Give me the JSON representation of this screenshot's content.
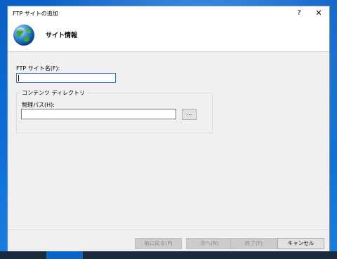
{
  "window": {
    "title": "FTP サイトの追加",
    "help_glyph": "?",
    "close_glyph": "✕"
  },
  "header": {
    "title": "サイト情報",
    "icon": "globe-icon"
  },
  "form": {
    "site_name_label": "FTP サイト名(F):",
    "site_name_value": "",
    "content_group_label": "コンテンツ ディレクトリ",
    "physical_path_label": "物理パス(H):",
    "physical_path_value": "",
    "browse_label": "..."
  },
  "buttons": {
    "back": "前に戻る(P)",
    "next": "次へ(N)",
    "finish": "終了(F)",
    "cancel": "キャンセル"
  },
  "colors": {
    "desktop": "#0d6fd6",
    "dialog_bg": "#f0f0f0",
    "focus_border": "#3b78d4",
    "disabled_text": "#8a8a8a"
  }
}
